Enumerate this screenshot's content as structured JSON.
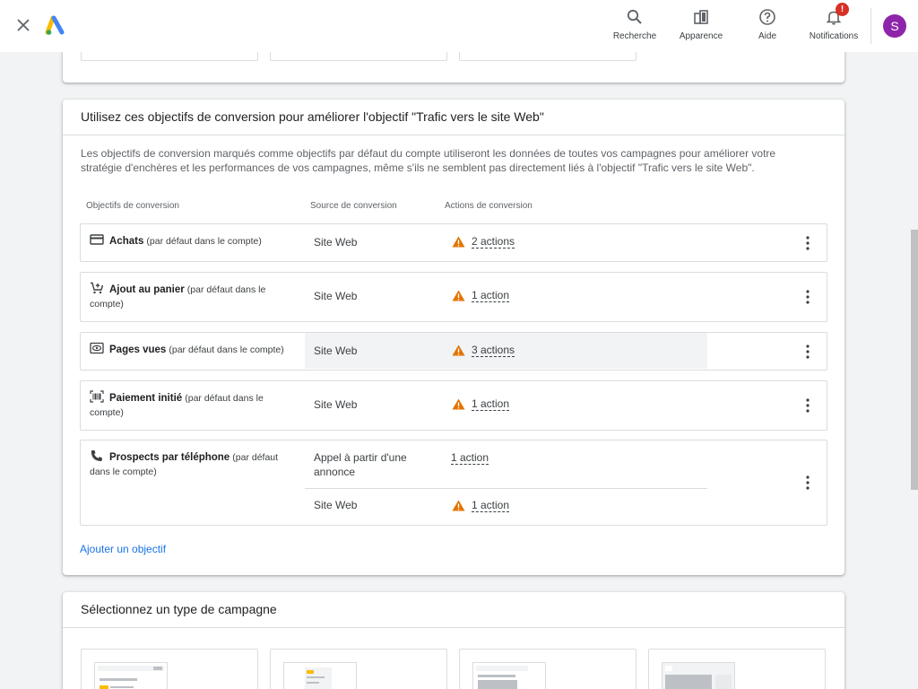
{
  "topbar": {
    "search_label": "Recherche",
    "appearance_label": "Apparence",
    "help_label": "Aide",
    "notifications_label": "Notifications",
    "notifications_badge": "!",
    "avatar_letter": "S"
  },
  "goals_section": {
    "title": "Utilisez ces objectifs de conversion pour améliorer l'objectif \"Trafic vers le site Web\"",
    "description": "Les objectifs de conversion marqués comme objectifs par défaut du compte utiliseront les données de toutes vos campagnes pour améliorer votre stratégie d'enchères et les performances de vos campagnes, même s'ils ne semblent pas directement liés à l'objectif \"Trafic vers le site Web\".",
    "columns": [
      "Objectifs de conversion",
      "Source de conversion",
      "Actions de conversion"
    ],
    "rows": [
      {
        "icon": "credit-card-icon",
        "name": "Achats",
        "note": "(par défaut dans le compte)",
        "sources": [
          {
            "source": "Site Web",
            "actions": "2 actions",
            "warning": true
          }
        ]
      },
      {
        "icon": "add-to-cart-icon",
        "name": "Ajout au panier",
        "note": "(par défaut dans le compte)",
        "sources": [
          {
            "source": "Site Web",
            "actions": "1 action",
            "warning": true
          }
        ]
      },
      {
        "icon": "page-view-icon",
        "name": "Pages vues",
        "note": "(par défaut dans le compte)",
        "sources": [
          {
            "source": "Site Web",
            "actions": "3 actions",
            "warning": true
          }
        ]
      },
      {
        "icon": "barcode-icon",
        "name": "Paiement initié",
        "note": "(par défaut dans le compte)",
        "sources": [
          {
            "source": "Site Web",
            "actions": "1 action",
            "warning": true
          }
        ]
      },
      {
        "icon": "phone-icon",
        "name": "Prospects par téléphone",
        "note": "(par défaut dans le compte)",
        "sources": [
          {
            "source": "Appel à partir d'une annonce",
            "actions": "1 action",
            "warning": false
          },
          {
            "source": "Site Web",
            "actions": "1 action",
            "warning": true
          }
        ]
      }
    ],
    "add_goal_link": "Ajouter un objectif"
  },
  "campaign_section": {
    "title": "Sélectionnez un type de campagne"
  },
  "colors": {
    "accent": "#1a73e8",
    "warning": "#e37400",
    "avatar": "#8e24aa",
    "badge": "#d93025"
  }
}
